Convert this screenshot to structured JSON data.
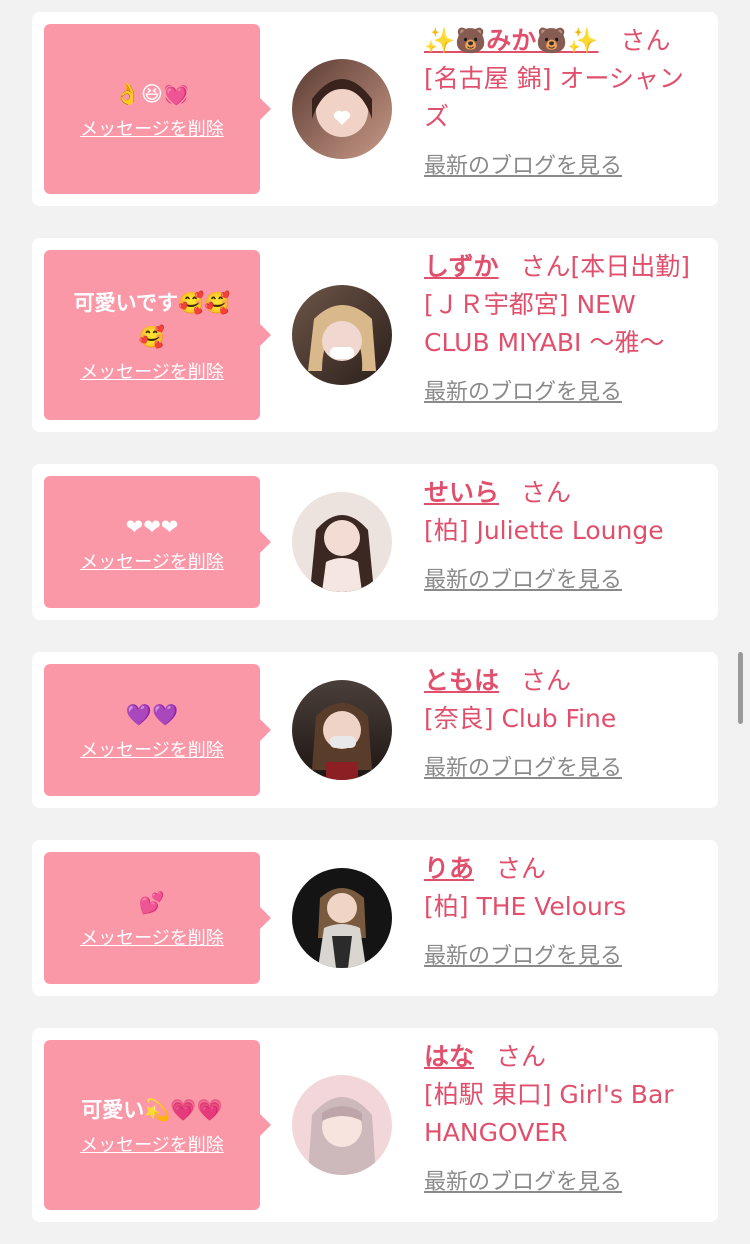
{
  "delete_label": "メッセージを削除",
  "blog_label": "最新のブログを見る",
  "san": "さん",
  "colors": {
    "bubble": "#fb98a8",
    "accent": "#e0506c",
    "link_gray": "#8a8a8a",
    "bg": "#f2f2f2"
  },
  "items": [
    {
      "message": "👌😆💓",
      "name": "✨🐻みか🐻✨",
      "name_suffix": "",
      "shop": "[名古屋 錦] オーシャンズ",
      "avatar": "avatar-photo"
    },
    {
      "message": "可愛いです🥰🥰🥰",
      "name": "しずか",
      "name_suffix": "[本日出勤]",
      "shop": "[ＪＲ宇都宮] NEW CLUB MIYABI 〜雅〜",
      "avatar": "avatar-photo"
    },
    {
      "message": "❤❤❤",
      "name": "せいら",
      "name_suffix": "",
      "shop": "[柏] Juliette Lounge",
      "avatar": "avatar-photo"
    },
    {
      "message": "💜💜",
      "name": "ともは",
      "name_suffix": "",
      "shop": "[奈良] Club Fine",
      "avatar": "avatar-photo"
    },
    {
      "message": "💕",
      "name": "りあ",
      "name_suffix": "",
      "shop": "[柏] THE Velours",
      "avatar": "avatar-photo"
    },
    {
      "message": "可愛い💫💗💗",
      "name": "はな",
      "name_suffix": "",
      "shop": "[柏駅 東口] Girl's Bar HANGOVER",
      "avatar": "avatar-photo"
    }
  ]
}
